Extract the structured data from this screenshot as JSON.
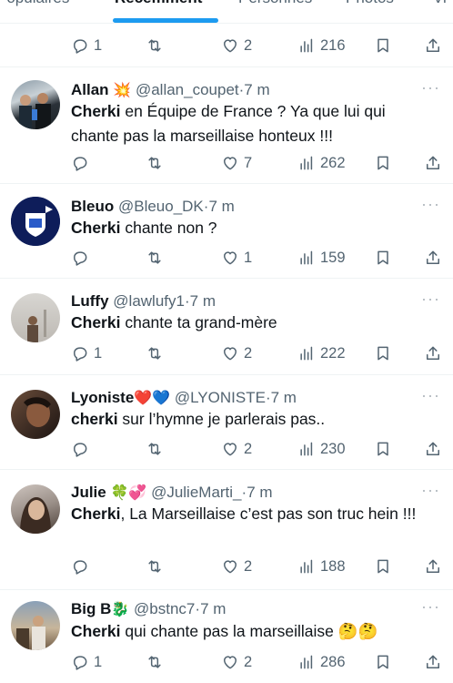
{
  "tabs": [
    {
      "label": "Populaires"
    },
    {
      "label": "Récemment"
    },
    {
      "label": "Personnes"
    },
    {
      "label": "Photos"
    },
    {
      "label": "Vi"
    }
  ],
  "top_actions": {
    "replies": "1",
    "retweets": "",
    "likes": "2",
    "views": "216"
  },
  "tweets": [
    {
      "name": "Allan",
      "name_emoji": "💥",
      "handle": "@allan_coupet",
      "time": "7 m",
      "text_bold": "Cherki",
      "text_rest": " en Équipe de France ? Ya que lui qui chante pas la marseillaise honteux !!!",
      "replies": "",
      "retweets": "",
      "likes": "7",
      "views": "262"
    },
    {
      "name": "Bleuo",
      "name_emoji": "",
      "handle": "@Bleuo_DK",
      "time": "7 m",
      "text_bold": "Cherki",
      "text_rest": " chante non ?",
      "replies": "",
      "retweets": "",
      "likes": "1",
      "views": "159"
    },
    {
      "name": "Luffy",
      "name_emoji": "",
      "handle": "@lawlufy1",
      "time": "7 m",
      "text_bold": "Cherki",
      "text_rest": " chante ta grand-mère",
      "replies": "1",
      "retweets": "",
      "likes": "2",
      "views": "222"
    },
    {
      "name": "Lyoniste",
      "name_emoji": "❤️💙",
      "handle": "@LYONISTE",
      "time": "7 m",
      "text_bold": "cherki",
      "text_rest": " sur l’hymne je parlerais pas..",
      "replies": "",
      "retweets": "",
      "likes": "2",
      "views": "230"
    },
    {
      "name": "Julie",
      "name_emoji": "🍀💞",
      "handle": "@JulieMarti_",
      "time": "7 m",
      "text_bold": "Cherki",
      "text_rest": ", La Marseillaise c’est pas son truc hein !!!",
      "replies": "",
      "retweets": "",
      "likes": "2",
      "views": "188"
    },
    {
      "name": "Big B",
      "name_emoji": "🐉",
      "handle": "@bstnc7",
      "time": "7 m",
      "text_bold": "Cherki",
      "text_rest": " qui chante pas la marseillaise 🤔🤔",
      "replies": "1",
      "retweets": "",
      "likes": "2",
      "views": "286"
    }
  ],
  "more_label": "···",
  "colors": {
    "accent": "#1d9bf0",
    "muted": "#536471",
    "divider": "#eff3f4"
  }
}
